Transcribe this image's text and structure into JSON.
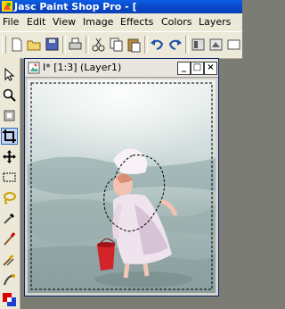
{
  "app": {
    "title": "Jasc Paint Shop Pro - [",
    "icon": "psp-app-icon"
  },
  "menu": [
    "File",
    "Edit",
    "View",
    "Image",
    "Effects",
    "Colors",
    "Layers"
  ],
  "toolbar": {
    "icons": [
      "new-icon",
      "open-icon",
      "save-icon",
      "print-icon",
      "cut-icon",
      "copy-icon",
      "paste-icon",
      "undo-icon",
      "redo-icon",
      "toggle-icon"
    ]
  },
  "tools": [
    "pointer-icon",
    "zoom-icon",
    "deform-icon",
    "crop-icon",
    "mover-icon",
    "selection-icon",
    "freehand-selection-icon",
    "dropper-icon",
    "paintbrush-icon",
    "clone-brush-icon",
    "color-replacer-icon",
    "retouch-icon",
    "swap-colors-icon"
  ],
  "document": {
    "title": "I* [1:3] (Layer1)",
    "minimize": "_",
    "maximize": "□",
    "close": "×"
  },
  "colors": {
    "app_title_bg": "#0a4fd6",
    "menu_bg": "#ece9d8",
    "workspace_bg": "#7b7c73",
    "doc_border": "#0a246a"
  }
}
